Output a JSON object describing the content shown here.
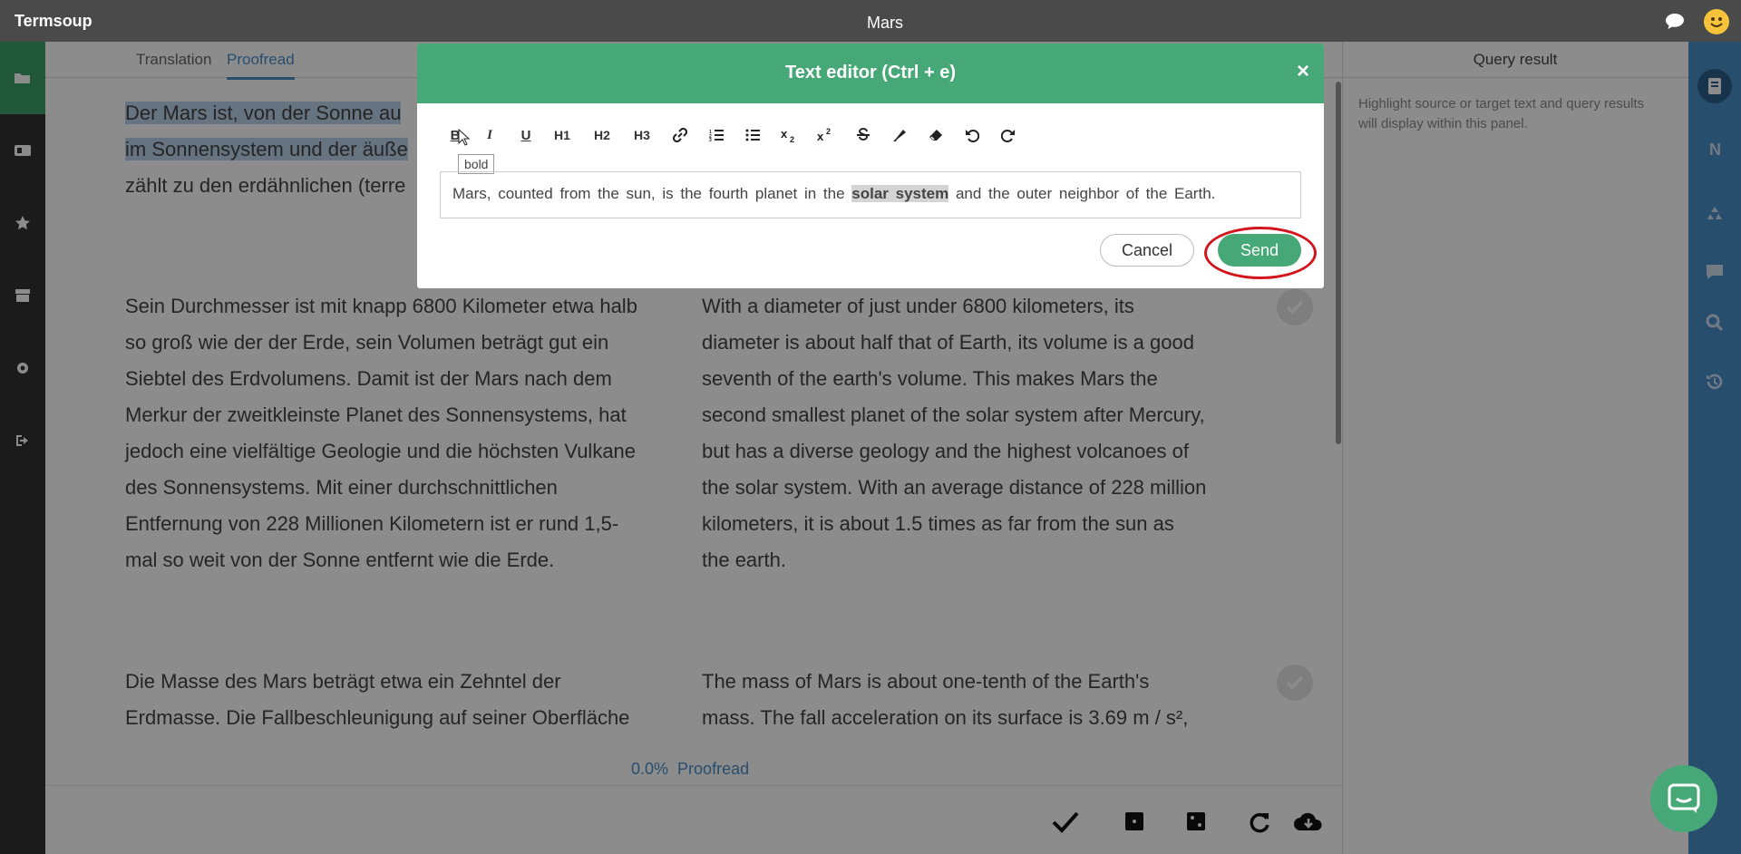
{
  "app": {
    "name": "Termsoup",
    "doc_title": "Mars"
  },
  "tabs": [
    "Translation",
    "Proofread"
  ],
  "segments": [
    {
      "source_lines": [
        "Der Mars ist, von der Sonne au",
        "im Sonnensystem und der äuße",
        "zählt zu den erdähnlichen (terre"
      ],
      "target_lines": []
    },
    {
      "source_lines": [
        "Sein Durchmesser ist mit knapp 6800 Kilometer etwa halb",
        "so groß wie der der Erde, sein Volumen beträgt gut ein",
        "Siebtel des Erdvolumens. Damit ist der Mars nach dem",
        "Merkur der zweitkleinste Planet des Sonnensystems, hat",
        "jedoch eine vielfältige Geologie und die höchsten Vulkane",
        "des Sonnensystems. Mit einer durchschnittlichen",
        "Entfernung von 228 Millionen Kilometern ist er rund 1,5-",
        "mal so weit von der Sonne entfernt wie die Erde."
      ],
      "target_lines": [
        "With a diameter of just under 6800 kilometers, its",
        "diameter is about half that of Earth, its volume is a good",
        "seventh of the earth's volume. This makes Mars the",
        "second smallest planet of the solar system after Mercury,",
        "but has a diverse geology and the highest volcanoes of",
        "the solar system. With an average distance of 228 million",
        "kilometers, it is about 1.5 times as far from the sun as",
        "the earth."
      ]
    },
    {
      "source_lines": [
        "Die Masse des Mars beträgt etwa ein Zehntel der",
        "Erdmasse. Die Fallbeschleunigung auf seiner Oberfläche"
      ],
      "target_lines": [
        "The mass of Mars is about one-tenth of the Earth's",
        "mass.  The fall acceleration on its surface is 3.69 m / s²,"
      ]
    }
  ],
  "progress": {
    "value": "0.0%",
    "label": "Proofread"
  },
  "right_panel": {
    "title": "Query result",
    "text": "Highlight source or target text and query results will display within this panel."
  },
  "modal": {
    "title": "Text editor (Ctrl + e)",
    "close": "×",
    "toolbar": [
      "B",
      "I",
      "U",
      "H1",
      "H2",
      "H3",
      "link-icon",
      "ordered-list-icon",
      "bullet-list-icon",
      "subscript-icon",
      "superscript-icon",
      "strikethrough-icon",
      "highlighter-icon",
      "eraser-icon",
      "undo-icon",
      "redo-icon"
    ],
    "tooltip": "bold",
    "text_before": "Mars, counted from the sun, is the fourth planet in the ",
    "text_selected": "solar system",
    "text_after": " and the outer neighbor of the Earth.",
    "cancel_label": "Cancel",
    "send_label": "Send"
  },
  "colors": {
    "accent": "#46a876",
    "nav_blue": "#4a8ec9",
    "highlight_ring": "#d2141c"
  }
}
